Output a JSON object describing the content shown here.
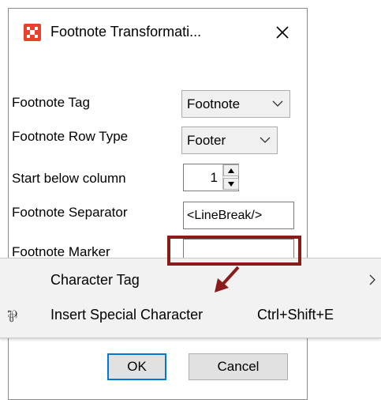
{
  "dialog": {
    "title": "Footnote Transformati...",
    "close_label": "✕"
  },
  "form": {
    "footnote_tag_label": "Footnote Tag",
    "footnote_tag_value": "Footnote",
    "row_type_label": "Footnote Row Type",
    "row_type_value": "Footer",
    "start_below_label": "Start below column",
    "start_below_value": "1",
    "separator_label": "Footnote Separator",
    "separator_value": "<LineBreak/>",
    "marker_label": "Footnote Marker",
    "marker_value": ""
  },
  "context_menu": {
    "items": [
      {
        "label": "Character Tag",
        "shortcut": "",
        "has_submenu": true,
        "icon": ""
      },
      {
        "label": "Insert Special Character",
        "shortcut": "Ctrl+Shift+E",
        "has_submenu": false,
        "icon": "special-character-icon"
      }
    ]
  },
  "buttons": {
    "ok_label": "OK",
    "cancel_label": "Cancel"
  },
  "colors": {
    "app_icon": "#e8422c",
    "highlight_annotation": "#8b1a1a",
    "default_button_border": "#0078d7"
  }
}
